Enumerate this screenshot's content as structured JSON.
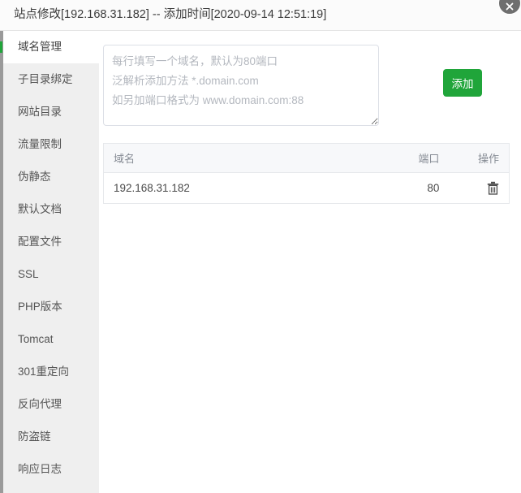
{
  "titlebar": {
    "title": "站点修改[192.168.31.182] -- 添加时间[2020-09-14 12:51:19]",
    "close_icon": "close-icon"
  },
  "sidebar": {
    "items": [
      {
        "label": "域名管理",
        "active": true
      },
      {
        "label": "子目录绑定",
        "active": false
      },
      {
        "label": "网站目录",
        "active": false
      },
      {
        "label": "流量限制",
        "active": false
      },
      {
        "label": "伪静态",
        "active": false
      },
      {
        "label": "默认文档",
        "active": false
      },
      {
        "label": "配置文件",
        "active": false
      },
      {
        "label": "SSL",
        "active": false
      },
      {
        "label": "PHP版本",
        "active": false
      },
      {
        "label": "Tomcat",
        "active": false
      },
      {
        "label": "301重定向",
        "active": false
      },
      {
        "label": "反向代理",
        "active": false
      },
      {
        "label": "防盗链",
        "active": false
      },
      {
        "label": "响应日志",
        "active": false
      }
    ]
  },
  "main": {
    "domain_input": {
      "value": "",
      "placeholder": "每行填写一个域名，默认为80端口\n泛解析添加方法 *.domain.com\n如另加端口格式为 www.domain.com:88"
    },
    "add_button": {
      "label": "添加",
      "color": "#20a53a"
    },
    "table": {
      "headers": [
        "域名",
        "端口",
        "操作"
      ],
      "rows": [
        {
          "domain": "192.168.31.182",
          "port": "80",
          "action_icon": "trash-icon"
        }
      ]
    }
  }
}
